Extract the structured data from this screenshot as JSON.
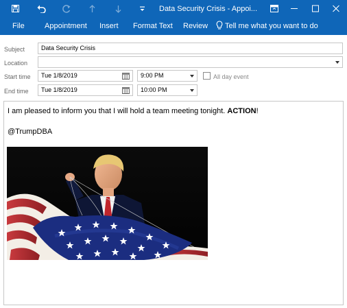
{
  "window": {
    "title": "Data Security Crisis  -  Appoi...",
    "colors": {
      "titlebar": "#0f66b8",
      "text": "#ffffff"
    }
  },
  "quick_access": {
    "icons": [
      "save-icon",
      "undo-icon",
      "redo-icon",
      "up-arrow-icon",
      "down-arrow-icon",
      "customize-icon"
    ]
  },
  "window_controls": {
    "icons": [
      "ribbon-display-icon",
      "minimize-icon",
      "maximize-icon",
      "close-icon"
    ]
  },
  "ribbon": {
    "tabs": [
      "File",
      "Appointment",
      "Insert",
      "Format Text",
      "Review"
    ],
    "tell_me": "Tell me what you want to do"
  },
  "form": {
    "subject_label": "Subject",
    "subject_value": "Data Security Crisis",
    "location_label": "Location",
    "location_value": "",
    "start_label": "Start time",
    "start_date": "Tue 1/8/2019",
    "start_time": "9:00 PM",
    "end_label": "End time",
    "end_date": "Tue 1/8/2019",
    "end_time": "10:00 PM",
    "all_day_label": "All day event",
    "all_day_checked": false
  },
  "body": {
    "message_prefix": "I am pleased to inform you that I will hold a team meeting tonight. ",
    "message_bold": "ACTION",
    "message_suffix": "!",
    "signature": "@TrumpDBA",
    "image": "photo-man-with-flag"
  }
}
